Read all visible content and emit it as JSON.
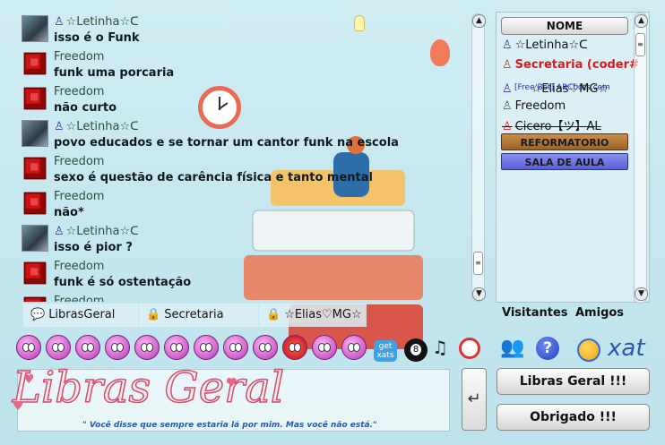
{
  "messages": [
    {
      "avatar": "photo",
      "name": "☆Letinha☆ᑕ",
      "text": "isso é o Funk",
      "man_icon": true
    },
    {
      "avatar": "cube",
      "name": "Freedom",
      "text": "funk uma porcaria",
      "man_icon": false
    },
    {
      "avatar": "cube",
      "name": "Freedom",
      "text": "não curto",
      "man_icon": false
    },
    {
      "avatar": "photo",
      "name": "☆Letinha☆ᑕ",
      "text": "povo educados e se tornar um cantor funk na escola",
      "man_icon": true
    },
    {
      "avatar": "cube",
      "name": "Freedom",
      "text": "sexo é questão de carência física e tanto mental",
      "man_icon": false
    },
    {
      "avatar": "cube",
      "name": "Freedom",
      "text": "não*",
      "man_icon": false
    },
    {
      "avatar": "photo",
      "name": "☆Letinha☆ᑕ",
      "text": "isso é pior ?",
      "man_icon": true
    },
    {
      "avatar": "cube",
      "name": "Freedom",
      "text": "funk é só ostentação",
      "man_icon": false
    },
    {
      "avatar": "cube",
      "name": "Freedom",
      "text": "",
      "man_icon": false
    }
  ],
  "tabs": [
    {
      "label": "LibrasGeral",
      "icon": "speech-bubble-icon"
    },
    {
      "label": "Secretaria",
      "icon": "lock-icon"
    },
    {
      "label": "☆Elias♡MG☆",
      "icon": "lock-icon"
    }
  ],
  "visitors_panel": {
    "header": "NOME",
    "users": [
      {
        "name": "☆Letinha☆ᑕ",
        "style": "normal"
      },
      {
        "name": "Secretaria (coder#",
        "style": "red"
      },
      {
        "name": "☆Elias♡MG☆",
        "style": "normal"
      },
      {
        "name": "Freedom",
        "style": "normal"
      },
      {
        "name": "Cicero【ツ】AL",
        "style": "strike"
      }
    ],
    "secretaria_sub": "[Free Bot] ARCbots.com",
    "room_buttons": [
      {
        "label": "REFORMATORIO",
        "color": "#a8692f"
      },
      {
        "label": "SALA DE AULA",
        "color": "#6f74e6"
      }
    ],
    "tab_visitors": "Visitantes",
    "tab_friends": "Amigos"
  },
  "toolbar": {
    "get_xats": "get xats",
    "ball_label": "8",
    "xat_word": "xat"
  },
  "input": {
    "logo_text": "Libras Geral",
    "logo_subtitle": "\" Você disse que sempre estaria lá por mim. Mas você não está.\""
  },
  "buttons": {
    "send": "↵",
    "libras_geral": "Libras Geral !!!",
    "obrigado": "Obrigado !!!"
  },
  "colors": {
    "red_user": "#d61c1c",
    "room_brown": "#a8692f",
    "room_blue": "#6f74e6",
    "xat_blue": "#2a58b0"
  }
}
